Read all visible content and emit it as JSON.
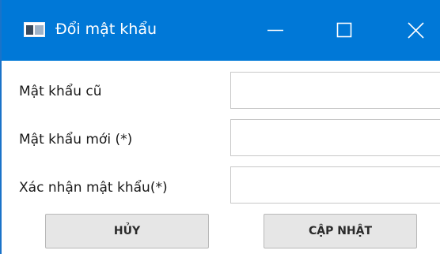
{
  "window": {
    "title": "Đổi mật khẩu",
    "accent_color": "#0078d7",
    "controls": {
      "minimize_icon": "minimize-icon",
      "maximize_icon": "maximize-icon",
      "close_icon": "close-icon"
    }
  },
  "form": {
    "fields": [
      {
        "label": "Mật khẩu cũ",
        "value": ""
      },
      {
        "label": "Mật khẩu mới (*)",
        "value": ""
      },
      {
        "label": "Xác nhận mật khẩu(*)",
        "value": ""
      }
    ]
  },
  "buttons": {
    "cancel_label": "HỦY",
    "update_label": "CẬP NHẬT"
  }
}
